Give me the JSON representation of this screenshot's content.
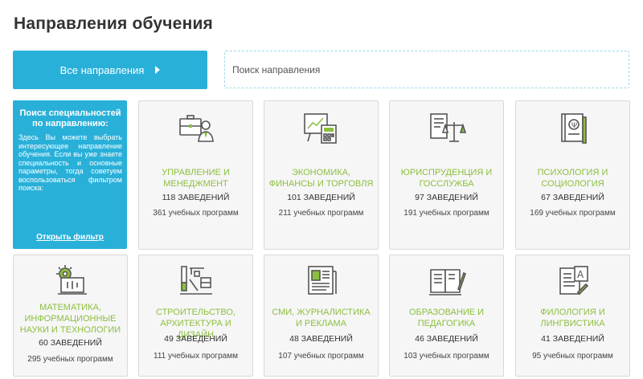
{
  "page": {
    "title": "Направления обучения"
  },
  "controls": {
    "all_directions_label": "Все направления",
    "search_placeholder": "Поиск направления"
  },
  "info": {
    "title": "Поиск специальностей по направлению:",
    "text": "Здесь Вы можете выбрать интересующее направление обучения. Если вы уже знаете специальность и основные параметры, тогда советуем воспользоваться фильтром поиска:",
    "link": "Открыть фильтр"
  },
  "colors": {
    "accent_blue": "#29b0d9",
    "category_green": "#8cbf3f",
    "icon_dark": "#555555"
  },
  "cards": [
    {
      "name": "Управление и менеджмент",
      "count": "118 заведений",
      "programs": "361 учебных программ",
      "icon": "briefcase-manager-icon"
    },
    {
      "name": "Экономика, финансы и торговля",
      "count": "101 заведений",
      "programs": "211 учебных программ",
      "icon": "chart-calculator-icon"
    },
    {
      "name": "Юриспруденция и госслужба",
      "count": "97 заведений",
      "programs": "191 учебных программ",
      "icon": "law-scales-icon"
    },
    {
      "name": "Психология и социология",
      "count": "67 заведений",
      "programs": "169 учебных программ",
      "icon": "psychology-book-icon"
    },
    {
      "name": "Математика, информационные науки и технологии",
      "count": "60 заведений",
      "programs": "295 учебных программ",
      "icon": "gear-laptop-icon"
    },
    {
      "name": "Строительство, архитектура и дизайн",
      "count": "49 заведений",
      "programs": "111 учебных программ",
      "icon": "construction-tools-icon"
    },
    {
      "name": "СМИ, журналистика и реклама",
      "count": "48 заведений",
      "programs": "107 учебных программ",
      "icon": "newspaper-icon"
    },
    {
      "name": "Образование и педагогика",
      "count": "46 заведений",
      "programs": "103 учебных программ",
      "icon": "open-book-pen-icon"
    },
    {
      "name": "Филология и лингвистика",
      "count": "41 заведений",
      "programs": "95 учебных программ",
      "icon": "language-book-icon"
    }
  ]
}
